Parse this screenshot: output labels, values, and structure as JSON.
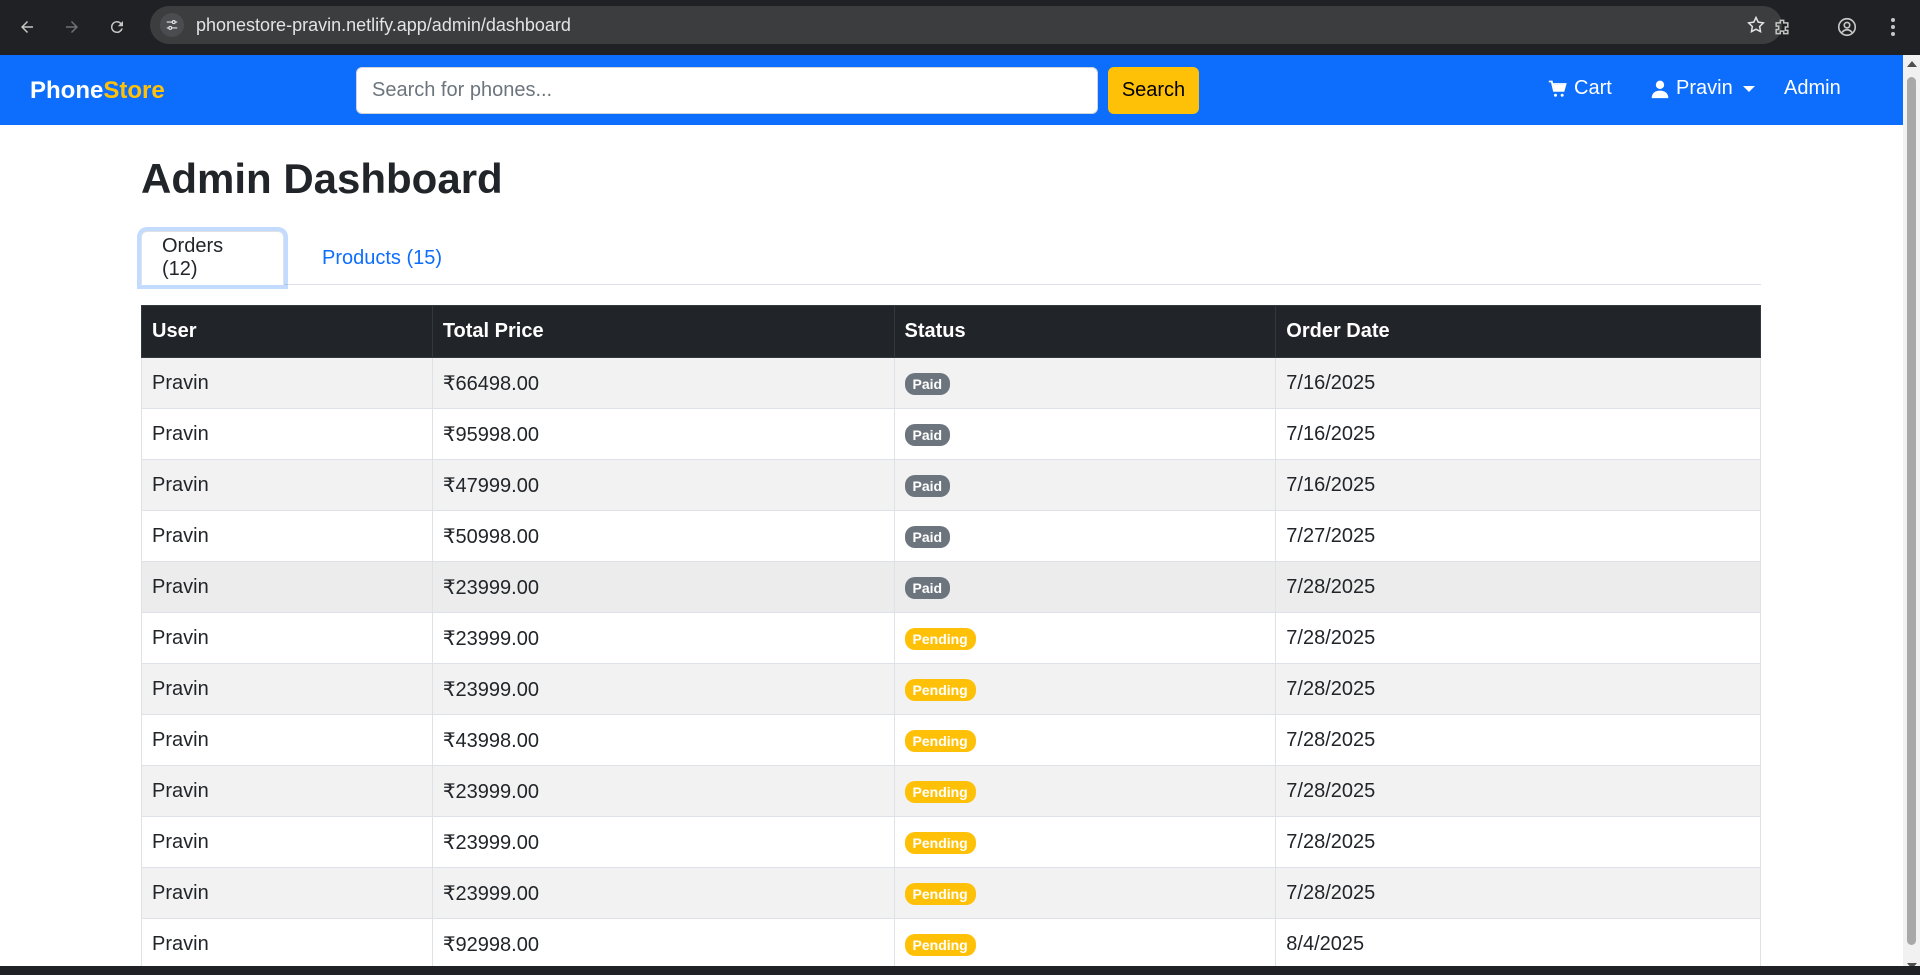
{
  "browser": {
    "url": "phonestore-pravin.netlify.app/admin/dashboard"
  },
  "navbar": {
    "brand_part1": "Phone",
    "brand_part2": "Store",
    "search_placeholder": "Search for phones...",
    "search_button": "Search",
    "cart_label": "Cart",
    "user_label": "Pravin",
    "admin_label": "Admin",
    "colors": {
      "primary": "#0d6efd",
      "accent": "#ffc107"
    }
  },
  "main": {
    "title": "Admin Dashboard",
    "tabs": [
      {
        "label": "Orders (12)",
        "active": true
      },
      {
        "label": "Products (15)",
        "active": false
      }
    ],
    "table": {
      "headers": [
        "User",
        "Total Price",
        "Status",
        "Order Date"
      ],
      "rows": [
        {
          "user": "Pravin",
          "total": "₹66498.00",
          "status": "Paid",
          "date": "7/16/2025"
        },
        {
          "user": "Pravin",
          "total": "₹95998.00",
          "status": "Paid",
          "date": "7/16/2025"
        },
        {
          "user": "Pravin",
          "total": "₹47999.00",
          "status": "Paid",
          "date": "7/16/2025"
        },
        {
          "user": "Pravin",
          "total": "₹50998.00",
          "status": "Paid",
          "date": "7/27/2025"
        },
        {
          "user": "Pravin",
          "total": "₹23999.00",
          "status": "Paid",
          "date": "7/28/2025"
        },
        {
          "user": "Pravin",
          "total": "₹23999.00",
          "status": "Pending",
          "date": "7/28/2025"
        },
        {
          "user": "Pravin",
          "total": "₹23999.00",
          "status": "Pending",
          "date": "7/28/2025"
        },
        {
          "user": "Pravin",
          "total": "₹43998.00",
          "status": "Pending",
          "date": "7/28/2025"
        },
        {
          "user": "Pravin",
          "total": "₹23999.00",
          "status": "Pending",
          "date": "7/28/2025"
        },
        {
          "user": "Pravin",
          "total": "₹23999.00",
          "status": "Pending",
          "date": "7/28/2025"
        },
        {
          "user": "Pravin",
          "total": "₹23999.00",
          "status": "Pending",
          "date": "7/28/2025"
        },
        {
          "user": "Pravin",
          "total": "₹92998.00",
          "status": "Pending",
          "date": "8/4/2025"
        }
      ]
    }
  }
}
